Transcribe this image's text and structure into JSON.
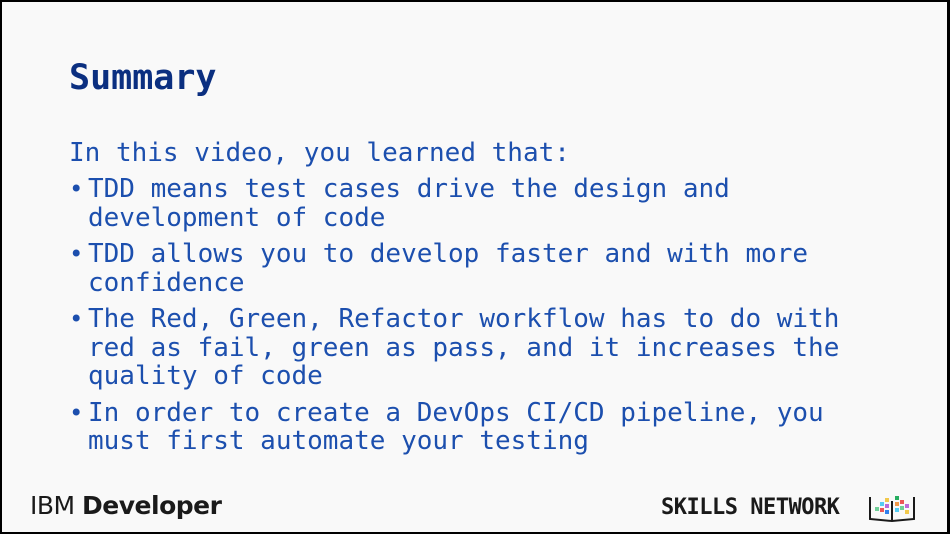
{
  "slide": {
    "title": "Summary",
    "intro": "In this video, you learned that:",
    "bullets": [
      {
        "lines": [
          "TDD means test cases drive the design and",
          "development of code"
        ]
      },
      {
        "lines": [
          "TDD allows you to develop faster and with more",
          "confidence"
        ]
      },
      {
        "lines": [
          "The Red, Green, Refactor workflow has to do with",
          "red as fail, green as pass, and it increases the",
          "quality of code"
        ]
      },
      {
        "lines": [
          "In order to create a DevOps CI/CD pipeline, you",
          "must first automate your testing"
        ]
      }
    ],
    "bullet_glyph": "•"
  },
  "footer": {
    "brand_light": "IBM ",
    "brand_bold": "Developer",
    "skills_network": "SKILLS NETWORK",
    "skills_logo_icon": "book-pixel-icon"
  },
  "colors": {
    "title": "#0b2f80",
    "body": "#1c4fae",
    "background": "#f9f9f9",
    "footer_text": "#1a1a1a"
  }
}
